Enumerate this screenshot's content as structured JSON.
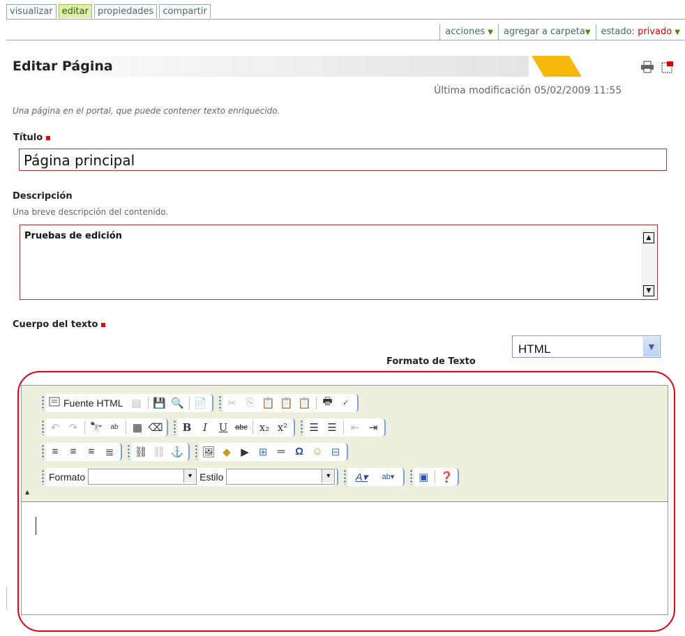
{
  "tabs": [
    {
      "label": "visualizar",
      "active": false
    },
    {
      "label": "editar",
      "active": true
    },
    {
      "label": "propiedades",
      "active": false
    },
    {
      "label": "compartir",
      "active": false
    }
  ],
  "actions": {
    "acciones": "acciones",
    "agregar": "agregar a carpeta",
    "estado_label": "estado:",
    "estado_value": "privado"
  },
  "page": {
    "title": "Editar Página",
    "last_modified": "Última modificación 05/02/2009 11:55",
    "type_description": "Una página en el portal, que puede contener texto enriquecido."
  },
  "fields": {
    "titulo_label": "Título",
    "titulo_value": "Página principal",
    "descripcion_label": "Descripción",
    "descripcion_help": "Una breve descripción del contenido.",
    "descripcion_value": "Pruebas de edición",
    "cuerpo_label": "Cuerpo del texto",
    "formato_label": "Formato de Texto",
    "formato_value": "HTML"
  },
  "editor": {
    "fuente_html": "Fuente HTML",
    "formato_label": "Formato",
    "estilo_label": "Estilo"
  },
  "colors": {
    "accent_gold": "#f6b80e",
    "required_red": "#ee0000",
    "highlight_frame": "#e30016"
  }
}
